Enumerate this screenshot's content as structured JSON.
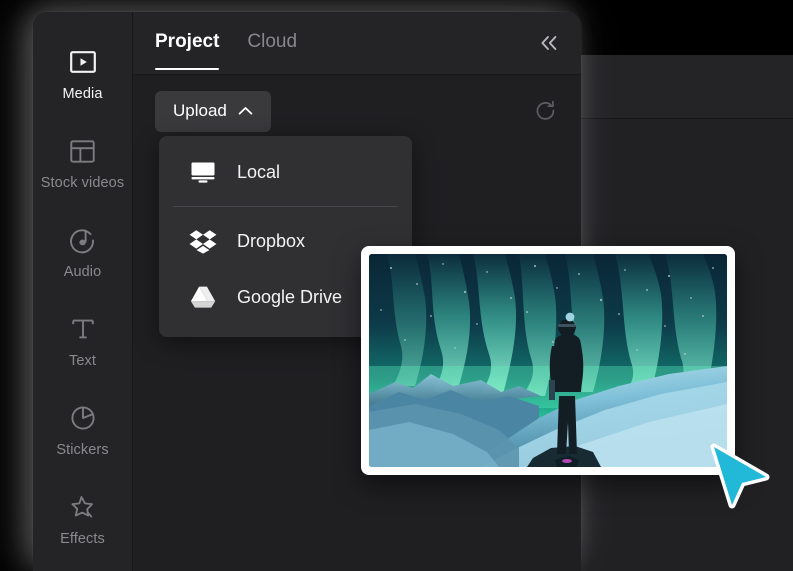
{
  "app": {
    "accent_cyan": "#22b8d8",
    "panel_bg": "#212124",
    "rail_bg": "#242426",
    "menu_bg": "#303033"
  },
  "sidebar": {
    "items": [
      {
        "label": "Media",
        "icon": "media-play-rect-icon",
        "active": true
      },
      {
        "label": "Stock videos",
        "icon": "layout-grid-icon",
        "active": false
      },
      {
        "label": "Audio",
        "icon": "music-note-circle-icon",
        "active": false
      },
      {
        "label": "Text",
        "icon": "text-t-icon",
        "active": false
      },
      {
        "label": "Stickers",
        "icon": "sticker-circle-icon",
        "active": false
      },
      {
        "label": "Effects",
        "icon": "sparkle-star-icon",
        "active": false
      }
    ]
  },
  "tabs": [
    {
      "label": "Project",
      "active": true
    },
    {
      "label": "Cloud",
      "active": false
    }
  ],
  "header": {
    "collapse_icon": "double-chevron-left-icon"
  },
  "toolbar": {
    "upload_label": "Upload",
    "upload_chevron": "chevron-up-icon",
    "refresh_icon": "refresh-icon"
  },
  "upload_menu": {
    "items": [
      {
        "label": "Local",
        "icon": "monitor-icon"
      },
      {
        "label": "Dropbox",
        "icon": "dropbox-icon"
      },
      {
        "label": "Google Drive",
        "icon": "google-drive-icon"
      }
    ],
    "separator_after_index": 0
  },
  "drag_item": {
    "name": "aurora-borealis-photo",
    "alt": "Person standing on snowy mountain beneath green aurora borealis"
  },
  "cursor": {
    "name": "pointer-cursor",
    "color": "#22b8d8"
  }
}
